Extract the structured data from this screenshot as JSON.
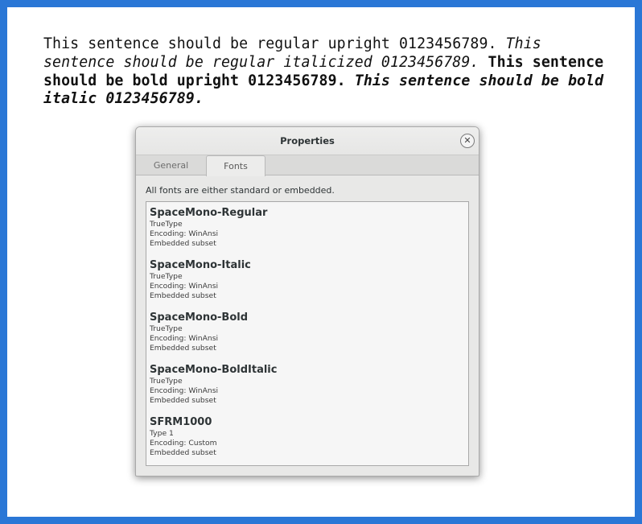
{
  "document": {
    "regular": "This sentence should be regular upright 0123456789.",
    "italic": "This sentence should be regular italicized 0123456789.",
    "bold": "This sentence should be bold upright 0123456789.",
    "bold_italic": "This sentence should be bold italic 0123456789."
  },
  "dialog": {
    "title": "Properties",
    "close_icon": "close-icon",
    "tabs": [
      {
        "label": "General",
        "selected": false
      },
      {
        "label": "Fonts",
        "selected": true
      }
    ],
    "summary": "All fonts are either standard or embedded.",
    "fonts": [
      {
        "name": "SpaceMono-Regular",
        "type": "TrueType",
        "encoding": "Encoding: WinAnsi",
        "embedding": "Embedded subset"
      },
      {
        "name": "SpaceMono-Italic",
        "type": "TrueType",
        "encoding": "Encoding: WinAnsi",
        "embedding": "Embedded subset"
      },
      {
        "name": "SpaceMono-Bold",
        "type": "TrueType",
        "encoding": "Encoding: WinAnsi",
        "embedding": "Embedded subset"
      },
      {
        "name": "SpaceMono-BoldItalic",
        "type": "TrueType",
        "encoding": "Encoding: WinAnsi",
        "embedding": "Embedded subset"
      },
      {
        "name": "SFRM1000",
        "type": "Type 1",
        "encoding": "Encoding: Custom",
        "embedding": "Embedded subset"
      }
    ]
  }
}
